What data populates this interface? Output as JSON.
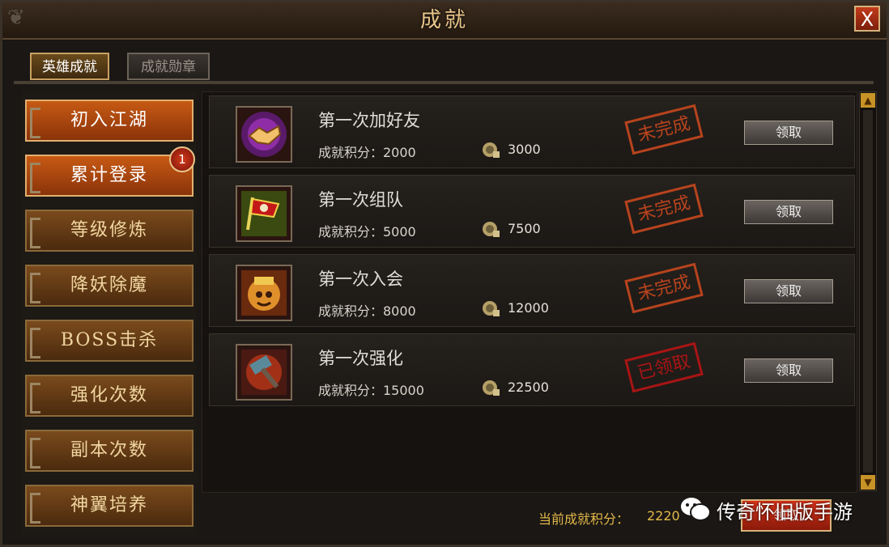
{
  "window": {
    "title": "成就",
    "close_label": "X"
  },
  "tabs": [
    {
      "label": "英雄成就",
      "active": true
    },
    {
      "label": "成就勋章",
      "active": false
    }
  ],
  "sidebar": {
    "items": [
      {
        "label": "初入江湖",
        "active": true
      },
      {
        "label": "累计登录",
        "active": false,
        "badge": "1"
      },
      {
        "label": "等级修炼",
        "active": false
      },
      {
        "label": "降妖除魔",
        "active": false
      },
      {
        "label": "BOSS击杀",
        "active": false
      },
      {
        "label": "强化次数",
        "active": false
      },
      {
        "label": "副本次数",
        "active": false
      },
      {
        "label": "神翼培养",
        "active": false
      }
    ]
  },
  "achievements": [
    {
      "name": "第一次加好友",
      "points": "成就积分：2000",
      "coins": "3000",
      "stamp": "未完成",
      "claim": "领取",
      "icon": "handshake-icon"
    },
    {
      "name": "第一次组队",
      "points": "成就积分：5000",
      "coins": "7500",
      "stamp": "未完成",
      "claim": "领取",
      "icon": "flag-icon"
    },
    {
      "name": "第一次入会",
      "points": "成就积分：8000",
      "coins": "12000",
      "stamp": "未完成",
      "claim": "领取",
      "icon": "guild-icon"
    },
    {
      "name": "第一次强化",
      "points": "成就积分：15000",
      "coins": "22500",
      "stamp": "已领取",
      "claim": "领取",
      "icon": "hammer-icon"
    }
  ],
  "footer": {
    "label": "当前成就积分：",
    "value": "2220",
    "button": "领取"
  },
  "watermark": {
    "text": "传奇怀旧版手游"
  },
  "colors": {
    "accent": "#c75a14",
    "stamp_pending": "#c8481e",
    "stamp_done": "#b81414",
    "gold": "#e3b84a"
  }
}
